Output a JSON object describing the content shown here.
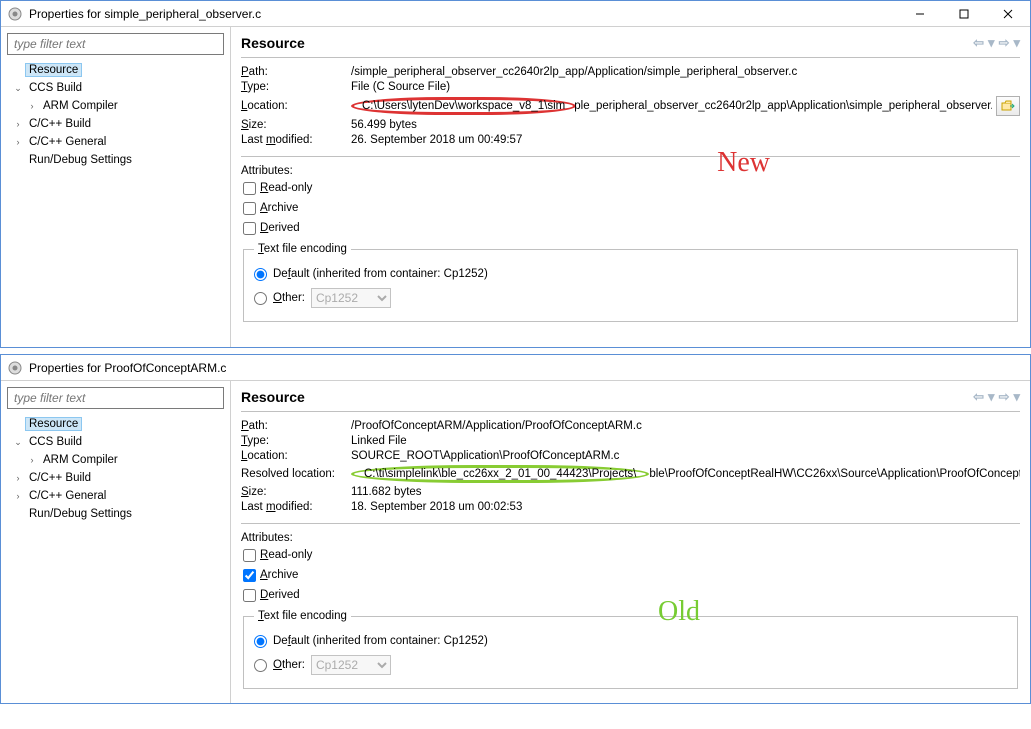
{
  "windows": [
    {
      "title": "Properties for simple_peripheral_observer.c",
      "showWinBtns": true,
      "filterPlaceholder": "type filter text",
      "tree": {
        "selected": "Resource",
        "items": [
          {
            "label": "Resource",
            "selected": true
          },
          {
            "label": "CCS Build",
            "expanded": true,
            "children": [
              {
                "label": "ARM Compiler",
                "leaf": true
              }
            ]
          },
          {
            "label": "C/C++ Build",
            "expanded": false
          },
          {
            "label": "C/C++ General",
            "expanded": false
          },
          {
            "label": "Run/Debug Settings"
          }
        ]
      },
      "sectionHeading": "Resource",
      "annot": {
        "text": "New",
        "cls": "new"
      },
      "props": [
        {
          "k": "Path:",
          "kUL": "P",
          "v": "/simple_peripheral_observer_cc2640r2lp_app/Application/simple_peripheral_observer.c"
        },
        {
          "k": "Type:",
          "kUL": "T",
          "v": "File  (C Source File)"
        },
        {
          "k": "Location:",
          "kUL": "L",
          "v_pre": "C:\\Users\\lytenDev\\workspace_v8_1\\sim",
          "v_circ": "red",
          "v_post": "ple_peripheral_observer_cc2640r2lp_app\\Application\\simple_peripheral_observer.c",
          "btn": true
        },
        {
          "k": "Size:",
          "kUL": "S",
          "v": "56.499  bytes"
        },
        {
          "k": "Last modified:",
          "kUL": "m",
          "kPrefix": "Last ",
          "v": "26. September 2018 um 00:49:57"
        }
      ],
      "attributesLabel": "Attributes:",
      "attrs": [
        {
          "label": "Read-only",
          "ul": "R",
          "checked": false
        },
        {
          "label": "Archive",
          "ul": "A",
          "checked": false
        },
        {
          "label": "Derived",
          "ul": "D",
          "checked": false
        }
      ],
      "encoding": {
        "legend": "Text file encoding",
        "legendUL": "T",
        "defaultLabel": "Default (inherited from container: Cp1252)",
        "defaultUL": "f",
        "otherLabel": "Other:",
        "otherUL": "O",
        "otherValue": "Cp1252",
        "selected": "default"
      }
    },
    {
      "title": "Properties for ProofOfConceptARM.c",
      "showWinBtns": false,
      "filterPlaceholder": "type filter text",
      "tree": {
        "selected": "Resource",
        "items": [
          {
            "label": "Resource",
            "selected": true
          },
          {
            "label": "CCS Build",
            "expanded": true,
            "children": [
              {
                "label": "ARM Compiler",
                "leaf": true
              }
            ]
          },
          {
            "label": "C/C++ Build",
            "expanded": false
          },
          {
            "label": "C/C++ General",
            "expanded": false
          },
          {
            "label": "Run/Debug Settings"
          }
        ]
      },
      "sectionHeading": "Resource",
      "annot": {
        "text": "Old",
        "cls": "old"
      },
      "props": [
        {
          "k": "Path:",
          "kUL": "P",
          "v": "/ProofOfConceptARM/Application/ProofOfConceptARM.c"
        },
        {
          "k": "Type:",
          "kUL": "T",
          "v": "Linked File"
        },
        {
          "k": "Location:",
          "kUL": "L",
          "v": "SOURCE_ROOT\\Application\\ProofOfConceptARM.c"
        },
        {
          "k": "Resolved location:",
          "v_pre": "C:\\ti\\simplelink\\ble_cc26xx_2_01_00_44423\\Projects\\",
          "v_circ": "green",
          "v_post": "ble\\ProofOfConceptRealHW\\CC26xx\\Source\\Application\\ProofOfConceptA",
          "midcirc": true
        },
        {
          "k": "Size:",
          "kUL": "S",
          "v": "111.682  bytes"
        },
        {
          "k": "Last modified:",
          "kUL": "m",
          "kPrefix": "Last ",
          "v": "18. September 2018 um 00:02:53"
        }
      ],
      "attributesLabel": "Attributes:",
      "attrs": [
        {
          "label": "Read-only",
          "ul": "R",
          "checked": false
        },
        {
          "label": "Archive",
          "ul": "A",
          "checked": true
        },
        {
          "label": "Derived",
          "ul": "D",
          "checked": false
        }
      ],
      "encoding": {
        "legend": "Text file encoding",
        "legendUL": "T",
        "defaultLabel": "Default (inherited from container: Cp1252)",
        "defaultUL": "f",
        "otherLabel": "Other:",
        "otherUL": "O",
        "otherValue": "Cp1252",
        "selected": "default"
      }
    }
  ]
}
